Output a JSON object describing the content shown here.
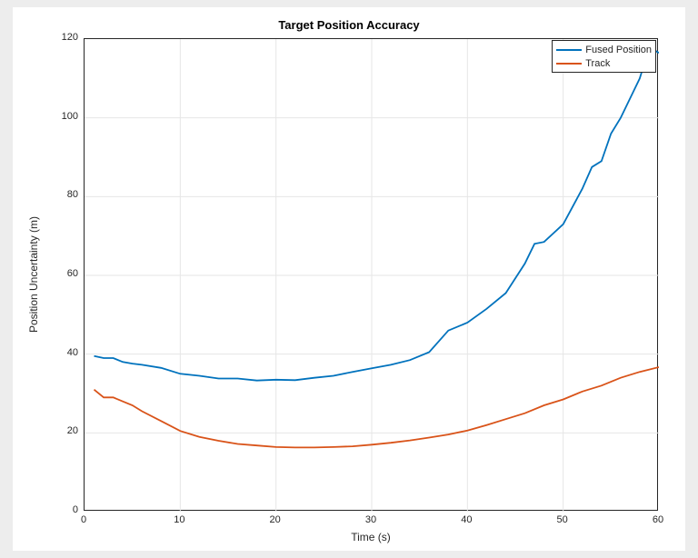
{
  "chart_data": {
    "type": "line",
    "title": "Target Position Accuracy",
    "xlabel": "Time (s)",
    "ylabel": "Position Uncertainty (m)",
    "xlim": [
      0,
      60
    ],
    "ylim": [
      0,
      120
    ],
    "xticks": [
      0,
      10,
      20,
      30,
      40,
      50,
      60
    ],
    "yticks": [
      0,
      20,
      40,
      60,
      80,
      100,
      120
    ],
    "legend_position": "northeast",
    "grid": true,
    "series": [
      {
        "name": "Fused Position",
        "color": "#0072BD",
        "x": [
          1,
          2,
          3,
          4,
          5,
          6,
          8,
          10,
          12,
          14,
          16,
          18,
          20,
          22,
          24,
          26,
          28,
          30,
          32,
          34,
          36,
          38,
          40,
          42,
          44,
          46,
          47,
          48,
          50,
          52,
          53,
          54,
          55,
          56,
          57,
          58,
          59,
          60
        ],
        "y": [
          39.5,
          39.0,
          39.0,
          38.0,
          37.6,
          37.3,
          36.5,
          35.0,
          34.5,
          33.8,
          33.8,
          33.3,
          33.5,
          33.4,
          34.0,
          34.5,
          35.5,
          36.4,
          37.3,
          38.5,
          40.5,
          46.0,
          48.0,
          51.5,
          55.5,
          63.0,
          68.0,
          68.5,
          73.0,
          82.0,
          87.5,
          89.0,
          96.0,
          100.0,
          105.0,
          110.0,
          118.0,
          116.5
        ]
      },
      {
        "name": "Track",
        "color": "#D95319",
        "x": [
          1,
          2,
          3,
          4,
          5,
          6,
          8,
          10,
          12,
          14,
          16,
          18,
          20,
          22,
          24,
          26,
          28,
          30,
          32,
          34,
          36,
          38,
          40,
          42,
          44,
          46,
          48,
          50,
          52,
          54,
          56,
          58,
          60
        ],
        "y": [
          31.0,
          29.0,
          29.0,
          28.0,
          27.0,
          25.5,
          23.0,
          20.5,
          19.0,
          18.0,
          17.2,
          16.8,
          16.4,
          16.3,
          16.3,
          16.4,
          16.6,
          17.0,
          17.5,
          18.1,
          18.8,
          19.6,
          20.6,
          22.0,
          23.5,
          25.0,
          27.0,
          28.5,
          30.5,
          32.0,
          34.0,
          35.5,
          36.7
        ]
      }
    ]
  }
}
